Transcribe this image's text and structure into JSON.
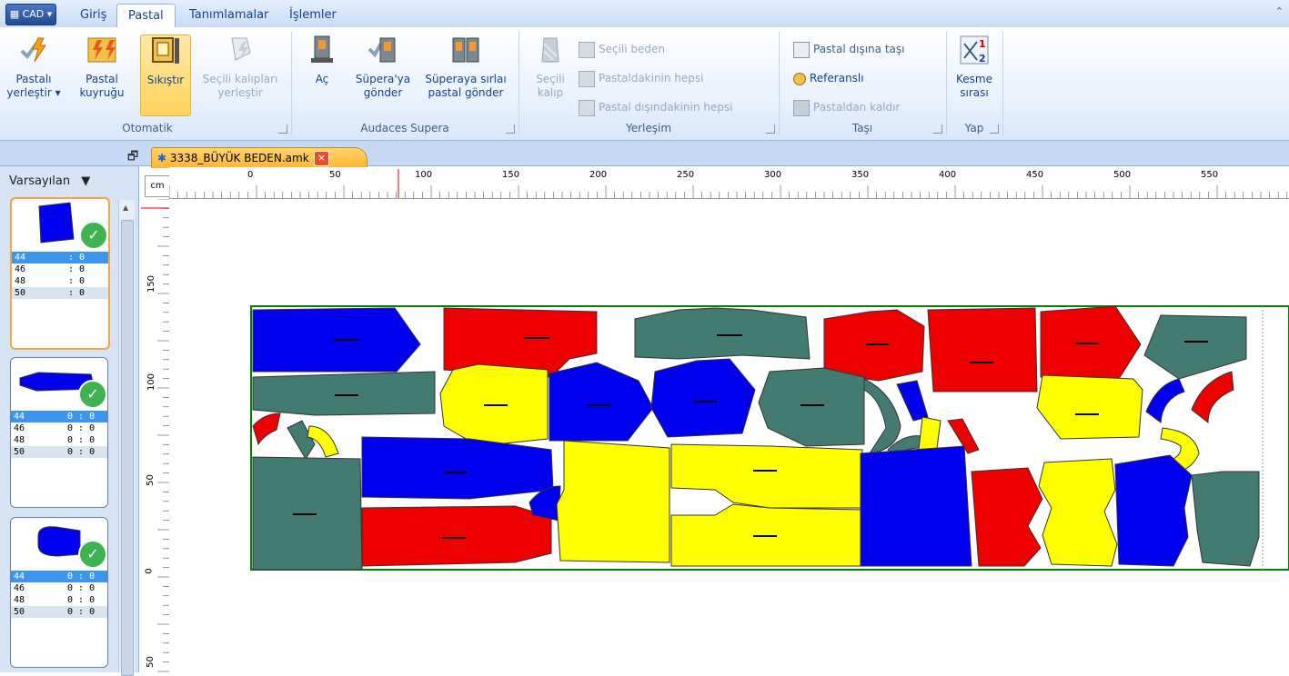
{
  "app_button": {
    "icon": "app-menu-icon",
    "label": "CAD"
  },
  "tabs": [
    {
      "label": "Giriş",
      "active": false
    },
    {
      "label": "Pastal",
      "active": true
    },
    {
      "label": "Tanımlamalar",
      "active": false
    },
    {
      "label": "İşlemler",
      "active": false
    }
  ],
  "ribbon": {
    "otomatik": {
      "label": "Otomatik",
      "pastali_yerlestir": [
        "Pastalı",
        "yerleştir ▾"
      ],
      "pastal_kuyrugu": [
        "Pastal",
        "kuyruğu"
      ],
      "sikistir": "Sıkıştır",
      "secili_kaliplari": [
        "Seçili kalıpları",
        "yerleştir"
      ]
    },
    "supera": {
      "label": "Audaces Supera",
      "ac": "Aç",
      "supera_gonder": [
        "Süpera'ya",
        "gönder"
      ],
      "sirali_gonder": [
        "Süperaya sırlaı",
        "pastal gönder"
      ]
    },
    "yerlesim": {
      "label": "Yerleşim",
      "secili_kalip": [
        "Seçili",
        "kalıp"
      ],
      "secili_beden": "Seçili beden",
      "pastaldakinin_hepsi": "Pastaldakinin hepsi",
      "pastal_disindakinin_hepsi": "Pastal dışındakinin hepsi"
    },
    "tasi": {
      "label": "Taşı",
      "pastal_disina_tasi": "Pastal dışına taşı",
      "referansli": "Referanslı",
      "pastaldan_kaldir": "Pastaldan kaldır"
    },
    "yap": {
      "label": "Yap",
      "kesme_sirasi": [
        "Kesme",
        "sırası"
      ]
    }
  },
  "document": {
    "tab_title": "3338_BÜYÜK BEDEN.amk",
    "close": "×"
  },
  "left_panel": {
    "preset": "Varsayılan",
    "cards": [
      {
        "rows": [
          [
            "44",
            ": 0"
          ],
          [
            "46",
            ": 0"
          ],
          [
            "48",
            ": 0"
          ],
          [
            "50",
            ": 0"
          ]
        ],
        "selected": true
      },
      {
        "rows": [
          [
            "44",
            "0 : 0"
          ],
          [
            "46",
            "0 : 0"
          ],
          [
            "48",
            "0 : 0"
          ],
          [
            "50",
            "0 : 0"
          ]
        ],
        "selected": false
      },
      {
        "rows": [
          [
            "44",
            "0 : 0"
          ],
          [
            "46",
            "0 : 0"
          ],
          [
            "48",
            "0 : 0"
          ],
          [
            "50",
            "0 : 0"
          ]
        ],
        "selected": false
      }
    ]
  },
  "ruler": {
    "unit": "cm",
    "h_ticks": [
      "0",
      "50",
      "100",
      "150",
      "200",
      "250",
      "300",
      "350",
      "400",
      "450",
      "500",
      "550"
    ],
    "v_ticks": [
      "150",
      "100",
      "50",
      "0",
      "50"
    ]
  },
  "colors": {
    "blue": "#0000ee",
    "red": "#ee0000",
    "teal": "#437a72",
    "yellow": "#ffff00",
    "border": "#008000"
  }
}
